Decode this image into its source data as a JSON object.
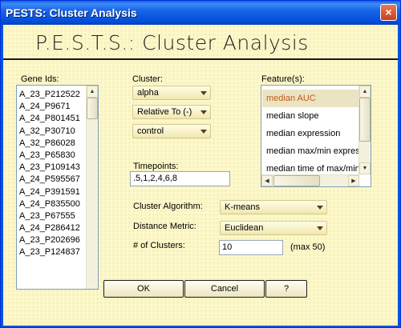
{
  "window": {
    "title": "PESTS: Cluster Analysis",
    "close_glyph": "×"
  },
  "banner": {
    "text": "P.E.S.T.S.: Cluster Analysis"
  },
  "gene_ids": {
    "label": "Gene Ids:",
    "items": [
      "A_23_P212522",
      "A_24_P9671",
      "A_24_P801451",
      "A_32_P30710",
      "A_32_P86028",
      "A_23_P65830",
      "A_23_P109143",
      "A_24_P595567",
      "A_24_P391591",
      "A_24_P835500",
      "A_23_P67555",
      "A_24_P286412",
      "A_23_P202696",
      "A_23_P124837"
    ]
  },
  "cluster": {
    "label": "Cluster:",
    "value": "alpha",
    "relative_to": "Relative To (-)",
    "control": "control"
  },
  "timepoints": {
    "label": "Timepoints:",
    "value": ".5,1,2,4,6,8"
  },
  "features": {
    "label": "Feature(s):",
    "items": [
      "median AUC",
      "median slope",
      "median expression",
      "median max/min expres",
      "median time of max/min"
    ],
    "selected_index": 0,
    "selected_color": "#c3581b"
  },
  "algorithm": {
    "label": "Cluster Algorithm:",
    "value": "K-means"
  },
  "distance": {
    "label": "Distance Metric:",
    "value": "Euclidean"
  },
  "num_clusters": {
    "label": "# of Clusters:",
    "value": "10",
    "hint": "(max 50)"
  },
  "buttons": {
    "ok": "OK",
    "cancel": "Cancel",
    "help": "?"
  }
}
